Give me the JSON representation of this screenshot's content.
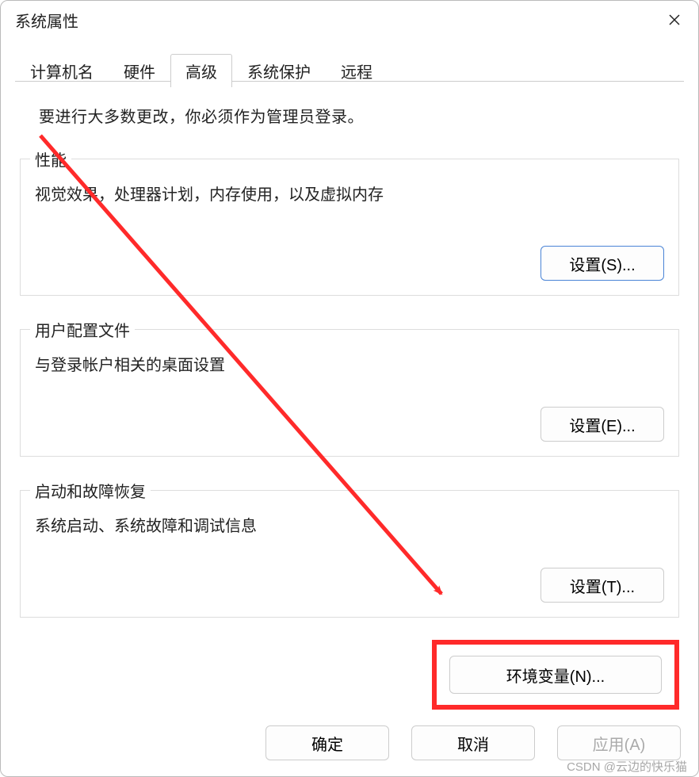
{
  "window": {
    "title": "系统属性",
    "close_icon": "close"
  },
  "tabs": [
    {
      "label": "计算机名",
      "active": false
    },
    {
      "label": "硬件",
      "active": false
    },
    {
      "label": "高级",
      "active": true
    },
    {
      "label": "系统保护",
      "active": false
    },
    {
      "label": "远程",
      "active": false
    }
  ],
  "admin_note": "要进行大多数更改，你必须作为管理员登录。",
  "groups": {
    "performance": {
      "legend": "性能",
      "desc": "视觉效果，处理器计划，内存使用，以及虚拟内存",
      "button": "设置(S)..."
    },
    "user_profiles": {
      "legend": "用户配置文件",
      "desc": "与登录帐户相关的桌面设置",
      "button": "设置(E)..."
    },
    "startup_recovery": {
      "legend": "启动和故障恢复",
      "desc": "系统启动、系统故障和调试信息",
      "button": "设置(T)..."
    }
  },
  "env_button": "环境变量(N)...",
  "buttons": {
    "ok": "确定",
    "cancel": "取消",
    "apply": "应用(A)"
  },
  "watermark": "CSDN @云边的快乐猫",
  "annotation": {
    "arrow_color": "#ff2a2a"
  }
}
